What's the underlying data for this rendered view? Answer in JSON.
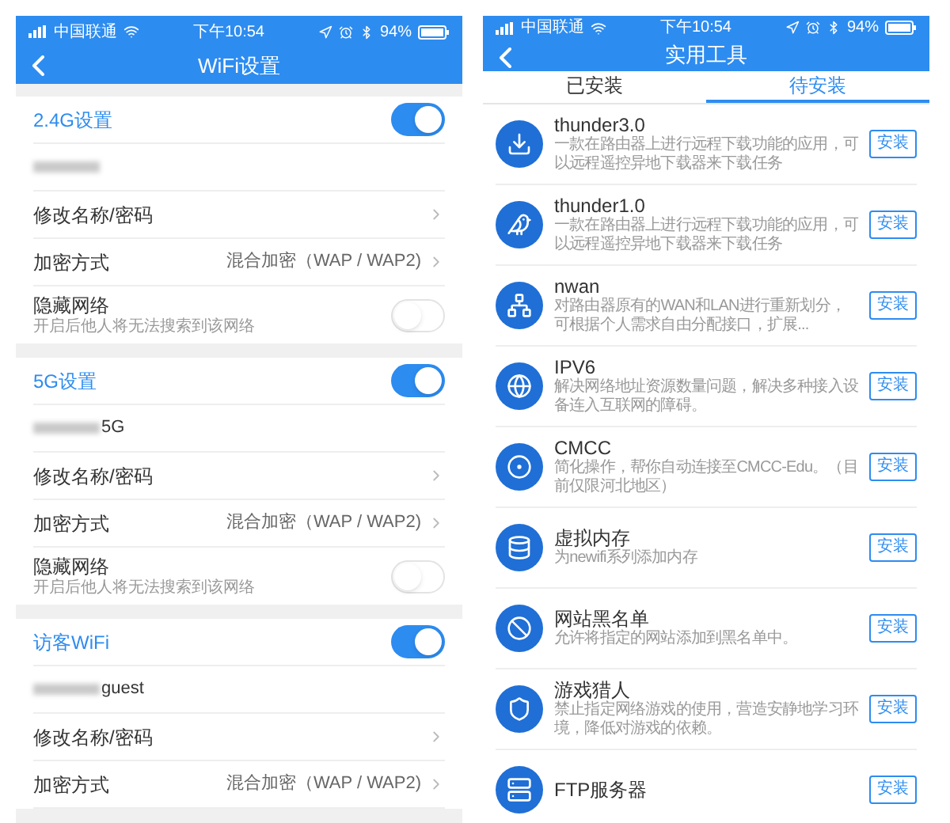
{
  "left": {
    "status_bar": {
      "carrier": "中国联通",
      "time": "下午10:54",
      "battery": "94%"
    },
    "title": "WiFi设置",
    "sections": [
      {
        "title": "2.4G设置",
        "on": true,
        "rows": [
          {
            "kind": "ssid"
          },
          {
            "kind": "link",
            "label": "修改名称/密码"
          },
          {
            "kind": "link",
            "label": "加密方式",
            "value": "混合加密（WAP / WAP2)"
          },
          {
            "kind": "toggle",
            "label": "隐藏网络",
            "hint": "开启后他人将无法搜索到该网络",
            "on": false
          }
        ]
      },
      {
        "title": "5G设置",
        "on": true,
        "rows": [
          {
            "kind": "ssid",
            "suffix": "5G"
          },
          {
            "kind": "link",
            "label": "修改名称/密码"
          },
          {
            "kind": "link",
            "label": "加密方式",
            "value": "混合加密（WAP / WAP2)"
          },
          {
            "kind": "toggle",
            "label": "隐藏网络",
            "hint": "开启后他人将无法搜索到该网络",
            "on": false
          }
        ]
      },
      {
        "title": "访客WiFi",
        "on": true,
        "rows": [
          {
            "kind": "ssid",
            "suffix": "guest"
          },
          {
            "kind": "link",
            "label": "修改名称/密码"
          },
          {
            "kind": "link",
            "label": "加密方式",
            "value": "混合加密（WAP / WAP2)"
          }
        ]
      }
    ]
  },
  "right": {
    "status_bar": {
      "carrier": "中国联通",
      "time": "下午10:54",
      "battery": "94%"
    },
    "title": "实用工具",
    "tabs": [
      {
        "label": "已安装",
        "selected": false
      },
      {
        "label": "待安装",
        "selected": true
      }
    ],
    "apps": [
      {
        "name": "thunder3.0",
        "description": "一款在路由器上进行远程下载功能的应用，可以远程遥控异地下载器来下载任务",
        "button": "安装"
      },
      {
        "name": "thunder1.0",
        "description": "一款在路由器上进行远程下载功能的应用，可以远程遥控异地下载器来下载任务",
        "button": "安装"
      },
      {
        "name": "nwan",
        "description": "对路由器原有的WAN和LAN进行重新划分，可根据个人需求自由分配接口，扩展...",
        "button": "安装"
      },
      {
        "name": "IPV6",
        "description": "解决网络地址资源数量问题，解决多种接入设备连入互联网的障碍。",
        "button": "安装"
      },
      {
        "name": "CMCC",
        "description": "简化操作，帮你自动连接至CMCC-Edu。（目前仅限河北地区）",
        "button": "安装"
      },
      {
        "name": "虚拟内存",
        "description": "为newifi系列添加内存",
        "button": "安装"
      },
      {
        "name": "网站黑名单",
        "description": "允许将指定的网站添加到黑名单中。",
        "button": "安装"
      },
      {
        "name": "游戏猎人",
        "description": "禁止指定网络游戏的使用，营造安静地学习环境，降低对游戏的依赖。",
        "button": "安装"
      },
      {
        "name": "FTP服务器",
        "button": "安装"
      }
    ]
  }
}
